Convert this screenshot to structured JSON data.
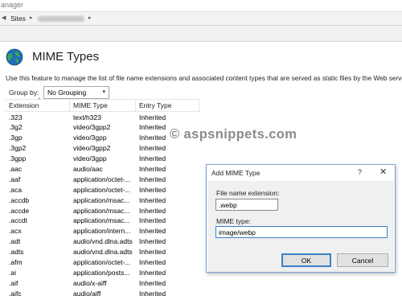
{
  "window": {
    "title_fragment": "anager"
  },
  "address_bar": {
    "arrow": "◀",
    "sites_label": "Sites",
    "separator": "▸"
  },
  "page": {
    "title": "MIME Types",
    "description": "Use this feature to manage the list of file name extensions and associated content types that are served as static files by the Web server."
  },
  "grouping": {
    "label": "Group by:",
    "selected": "No Grouping",
    "chevron": "▾"
  },
  "grid": {
    "columns": [
      "Extension",
      "MIME Type",
      "Entry Type"
    ],
    "sort_indicator": "˄",
    "rows": [
      [
        ".323",
        "text/h323",
        "Inherited"
      ],
      [
        ".3g2",
        "video/3gpp2",
        "Inherited"
      ],
      [
        ".3gp",
        "video/3gpp",
        "Inherited"
      ],
      [
        ".3gp2",
        "video/3gpp2",
        "Inherited"
      ],
      [
        ".3gpp",
        "video/3gpp",
        "Inherited"
      ],
      [
        ".aac",
        "audio/aac",
        "Inherited"
      ],
      [
        ".aaf",
        "application/octet-...",
        "Inherited"
      ],
      [
        ".aca",
        "application/octet-...",
        "Inherited"
      ],
      [
        ".accdb",
        "application/msac...",
        "Inherited"
      ],
      [
        ".accde",
        "application/msac...",
        "Inherited"
      ],
      [
        ".accdt",
        "application/msac...",
        "Inherited"
      ],
      [
        ".acx",
        "application/intern...",
        "Inherited"
      ],
      [
        ".adt",
        "audio/vnd.dlna.adts",
        "Inherited"
      ],
      [
        ".adts",
        "audio/vnd.dlna.adts",
        "Inherited"
      ],
      [
        ".afm",
        "application/octet-...",
        "Inherited"
      ],
      [
        ".ai",
        "application/posts...",
        "Inherited"
      ],
      [
        ".aif",
        "audio/x-aiff",
        "Inherited"
      ],
      [
        ".aifc",
        "audio/aiff",
        "Inherited"
      ]
    ]
  },
  "watermark": "© aspsnippets.com",
  "dialog": {
    "title": "Add MIME Type",
    "help_glyph": "?",
    "close_glyph": "✕",
    "extension_label": "File name extension:",
    "extension_value": ".webp",
    "mime_label": "MIME type:",
    "mime_value": "image/webp",
    "ok_label": "OK",
    "cancel_label": "Cancel"
  },
  "colors": {
    "accent": "#3c7fc8",
    "dialog_body": "#f0f0f0",
    "band": "#f0f0f0"
  }
}
